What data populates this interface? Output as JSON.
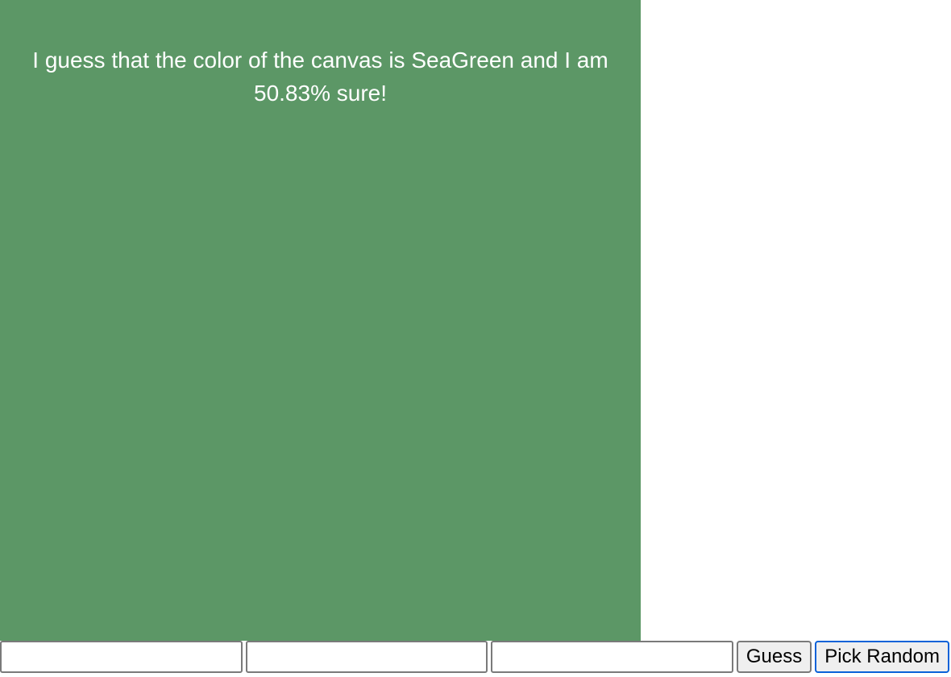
{
  "canvas": {
    "background_color": "#5c9766",
    "guess_text": "I guess that the color of the canvas is SeaGreen and I am 50.83% sure!",
    "guessed_color_name": "SeaGreen",
    "confidence_percent": 50.83
  },
  "controls": {
    "input_r_value": "",
    "input_g_value": "",
    "input_b_value": "",
    "guess_button_label": "Guess",
    "pick_random_button_label": "Pick Random"
  }
}
